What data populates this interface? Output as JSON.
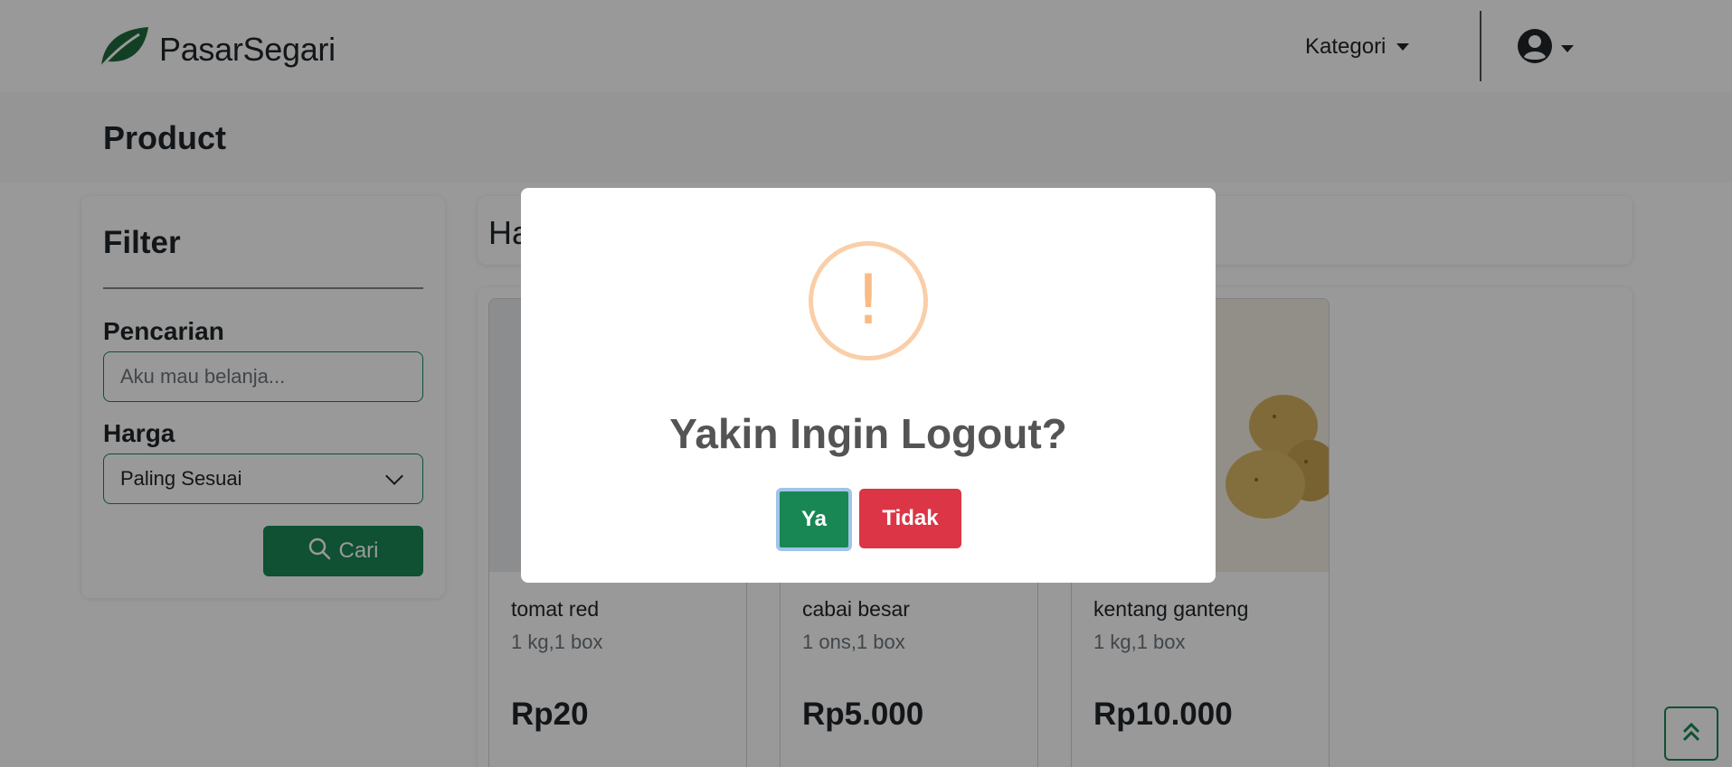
{
  "navbar": {
    "brand_name": "PasarSegari",
    "brand_icon": "leaf-icon",
    "category_label": "Kategori",
    "user_icon": "user-circle-icon"
  },
  "page": {
    "title": "Product"
  },
  "filter": {
    "title": "Filter",
    "search_label": "Pencarian",
    "search_placeholder": "Aku mau belanja...",
    "price_label": "Harga",
    "price_selected": "Paling Sesuai",
    "search_button": "Cari"
  },
  "results": {
    "header_partial": "Ha"
  },
  "products": [
    {
      "name": "tomat red",
      "unit": "1 kg,1 box",
      "price": "Rp20"
    },
    {
      "name": "cabai besar",
      "unit": "1 ons,1 box",
      "price": "Rp5.000"
    },
    {
      "name": "kentang ganteng",
      "unit": "1 kg,1 box",
      "price": "Rp10.000"
    }
  ],
  "modal": {
    "icon": "warning-icon",
    "icon_mark": "!",
    "title": "Yakin Ingin Logout?",
    "confirm_label": "Ya",
    "cancel_label": "Tidak"
  },
  "colors": {
    "primary": "#198754",
    "danger": "#dc3545",
    "warning": "#f8bb86"
  }
}
